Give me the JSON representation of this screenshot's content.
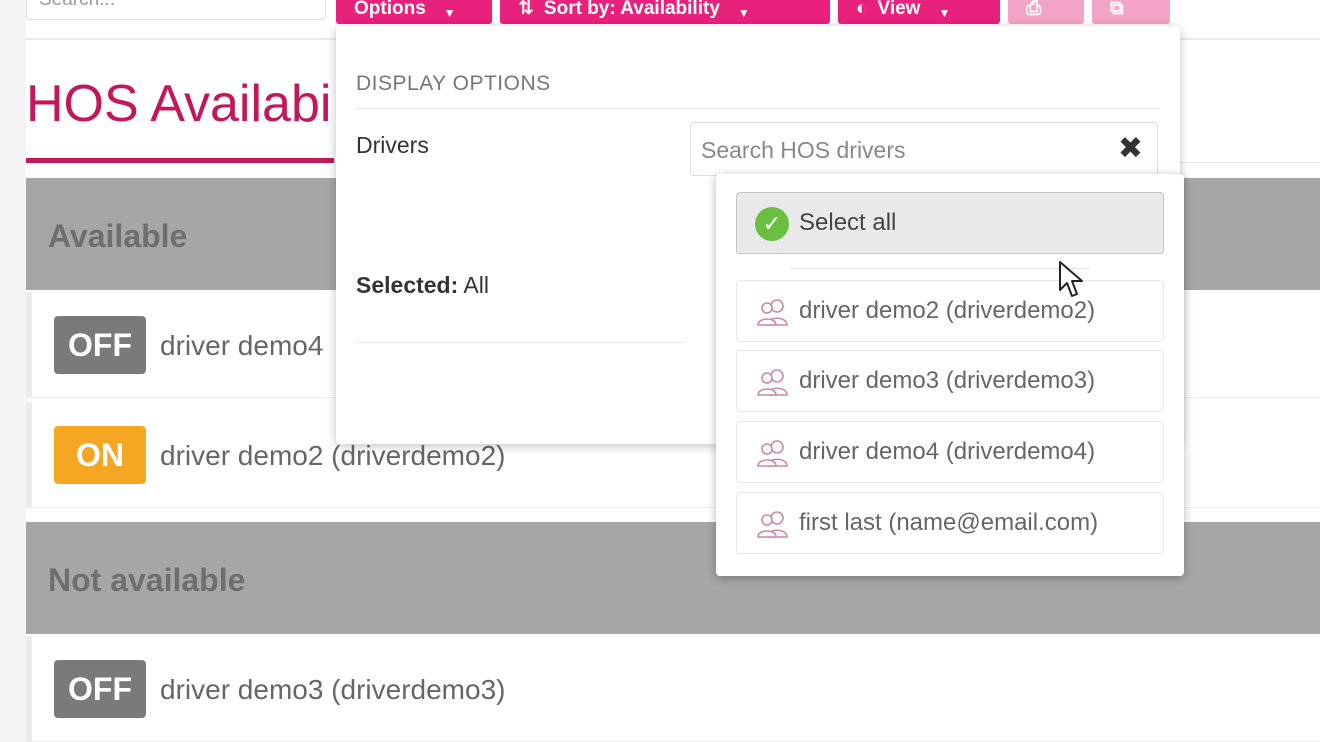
{
  "toolbar": {
    "search_placeholder": "Search...",
    "options_label": "Options",
    "sort_label": "Sort by: Availability",
    "view_label": "View"
  },
  "page": {
    "title": "HOS Availabi"
  },
  "groups": [
    {
      "header": "Available",
      "rows": [
        {
          "status": "OFF",
          "name": "driver demo4"
        },
        {
          "status": "ON",
          "name": "driver demo2 (driverdemo2)"
        }
      ]
    },
    {
      "header": "Not available",
      "rows": [
        {
          "status": "OFF",
          "name": "driver demo3 (driverdemo3)"
        }
      ]
    }
  ],
  "options_panel": {
    "heading": "DISPLAY OPTIONS",
    "drivers_label": "Drivers",
    "selected_label": "Selected:",
    "selected_value": "All",
    "driver_search_placeholder": "Search HOS drivers",
    "select_all_label": "Select all",
    "drivers": [
      "driver demo2 (driverdemo2)",
      "driver demo3 (driverdemo3)",
      "driver demo4 (driverdemo4)",
      "first last (name@email.com)"
    ]
  },
  "colors": {
    "accent": "#e8227c",
    "title": "#c2185b",
    "badge_off": "#7a7a7a",
    "badge_on": "#f5a623",
    "group_header": "#a6a6a6",
    "check": "#6abf40"
  }
}
